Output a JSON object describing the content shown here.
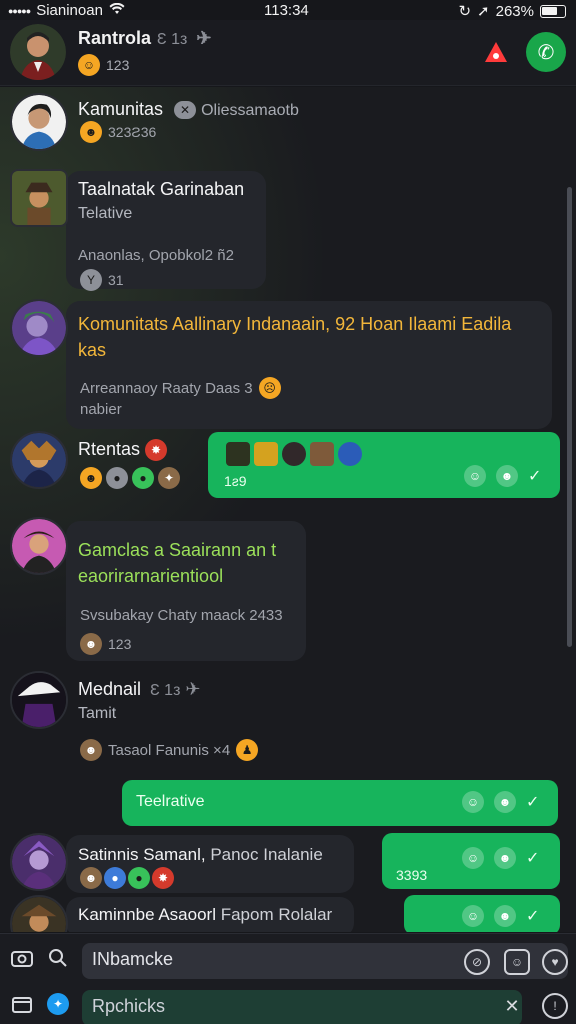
{
  "status": {
    "carrier": "Sianinoan",
    "time": "113:34",
    "battery": "263%"
  },
  "header": {
    "title": "Rantrola",
    "title_muted": "Ɛ 1з",
    "sub": "123"
  },
  "messages": [
    {
      "name": "Kamunitas",
      "tag": "Oliessamaotb",
      "meta": "323Ƨ36"
    },
    {
      "name": "Taalnatak Garinaban",
      "line2": "Telative",
      "line3": "Anaonlas, Opobkol2 ñ2",
      "meta": "31"
    },
    {
      "text": "Komunitats Aallinary Indanaain, 92 Hoan Ilaami Eadila kas",
      "line2": "Arreannaoy Raaty Daas 3",
      "line3": "nabier"
    },
    {
      "name": "Rtentas",
      "outgoing_time": "1ƨ9"
    },
    {
      "text": "Gamclas a Saairann an t eaorirarnarientiool",
      "line2": "Svsubakay Chaty maack 2433",
      "meta": "123"
    },
    {
      "name": "Mednail",
      "name_muted": "Ɛ 1з",
      "line2": "Tamit",
      "line3": "Tasaol Fanunis ×4"
    },
    {
      "outgoing_text": "Teelrative"
    },
    {
      "name": "Satinnis Samanl,",
      "name_tail": "Panoc Inalanie",
      "outgoing_time": "3393"
    },
    {
      "name": "Kaminnbe Asaoorl",
      "name_tail": "Fapom Rolalar"
    }
  ],
  "composer": {
    "input_value": "INbamcke",
    "input2_value": "Rpchicks"
  },
  "colors": {
    "accent_green": "#17b45c",
    "yellow_text": "#f2b63a",
    "lime_text": "#9be05a",
    "alert_red": "#ff3b3b"
  }
}
